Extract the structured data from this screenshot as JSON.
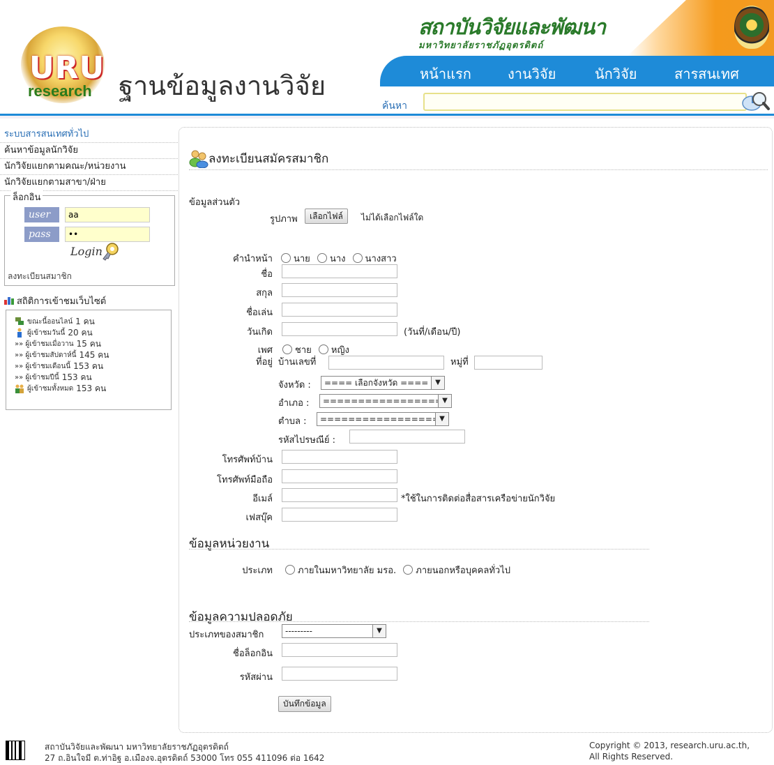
{
  "header": {
    "logo_main": "URU",
    "logo_sub": "research",
    "site_title": "ฐานข้อมูลงานวิจัย",
    "institute_name": "สถาบันวิจัยและพัฒนา",
    "institute_sub": "มหาวิทยาลัยราชภัฏอุตรดิตถ์",
    "nav": [
      "หน้าแรก",
      "งานวิจัย",
      "นักวิจัย",
      "สารสนเทศ"
    ],
    "search_label": "ค้นหา",
    "search_value": ""
  },
  "sidebar": {
    "links": [
      "ระบบสารสนเทศทั่วไป",
      "ค้นหาข้อมูลนักวิจัย",
      "นักวิจัยแยกตามคณะ/หน่วยงาน",
      "นักวิจัยแยกตามสาขา/ฝ่าย"
    ],
    "login": {
      "legend": "ล็อกอิน",
      "user_label": "user",
      "user_value": "aa",
      "pass_label": "pass",
      "pass_value": "••",
      "button": "Login",
      "register": "ลงทะเบียนสมาชิก"
    },
    "stats_title": "สถิติการเข้าชมเว็บไซต์",
    "stats": [
      {
        "label": "ขณะนี้ออนไลน์",
        "value": "1 คน",
        "icon": "online-users-icon"
      },
      {
        "label": "ผู้เข้าชมวันนี้",
        "value": "20 คน",
        "icon": "visitor-today-icon"
      },
      {
        "label": "»» ผู้เข้าชมเมื่อวาน",
        "value": "15 คน",
        "icon": ""
      },
      {
        "label": "»» ผู้เข้าชมสัปดาห์นี้",
        "value": "145 คน",
        "icon": ""
      },
      {
        "label": "»» ผู้เข้าชมเดือนนี้",
        "value": "153 คน",
        "icon": ""
      },
      {
        "label": "»» ผู้เข้าชมปีนี้",
        "value": "153 คน",
        "icon": ""
      },
      {
        "label": "ผู้เข้าชมทั้งหมด",
        "value": "153 คน",
        "icon": "total-users-icon"
      }
    ]
  },
  "form": {
    "title": "ลงทะเบียนสมัครสมาชิก",
    "personal_section": "ข้อมูลส่วนตัว",
    "photo_label": "รูปภาพ",
    "file_button": "เลือกไฟล์",
    "file_status": "ไม่ได้เลือกไฟล์ใด",
    "prefix_label": "คำนำหน้า",
    "prefix_options": [
      "นาย",
      "นาง",
      "นางสาว"
    ],
    "firstname_label": "ชื่อ",
    "lastname_label": "สกุล",
    "nickname_label": "ชื่อเล่น",
    "birthdate_label": "วันเกิด",
    "birthdate_hint": "(วันที่/เดือน/ปี)",
    "gender_label": "เพศ",
    "gender_options": [
      "ชาย",
      "หญิง"
    ],
    "address_label": "ที่อยู่",
    "house_no_label": "บ้านเลขที่",
    "moo_label": "หมู่ที่",
    "province_label": "จังหวัด :",
    "province_value": "==== เลือกจังหวัด ====",
    "district_label": "อำเภอ :",
    "district_value": "==================",
    "subdistrict_label": "ตำบล :",
    "subdistrict_value": "==================",
    "postcode_label": "รหัสไปรษณีย์ :",
    "home_phone_label": "โทรศัพท์บ้าน",
    "mobile_label": "โทรศัพท์มือถือ",
    "email_label": "อีเมล์",
    "email_hint": "*ใช้ในการติดต่อสื่อสารเครือข่ายนักวิจัย",
    "facebook_label": "เฟสบุ๊ค",
    "org_section": "ข้อมูลหน่วยงาน",
    "org_type_label": "ประเภท",
    "org_type_options": [
      "ภายในมหาวิทยาลัย มรอ.",
      "ภายนอกหรือบุคคลทั่วไป"
    ],
    "security_section": "ข้อมูลความปลอดภัย",
    "member_type_label": "ประเภทของสมาชิก",
    "member_type_value": "---------",
    "username_label": "ชื่อล็อกอิน",
    "password_label": "รหัสผ่าน",
    "submit_button": "บันทึกข้อมูล"
  },
  "footer": {
    "org": "สถาบันวิจัยและพัฒนา มหาวิทยาลัยราชภัฏอุตรดิตถ์",
    "address": "27 ถ.อินใจมี ต.ท่าอิฐ อ.เมืองจ.อุตรดิตถ์ 53000  โทร 055 411096 ต่อ 1642",
    "copyright": "Copyright © 2013, research.uru.ac.th,",
    "rights": "All Rights Reserved."
  },
  "colors": {
    "nav_blue": "#1e8bd8",
    "accent_orange": "#f39a21",
    "brand_green": "#2a7a2a",
    "link_blue": "#2a6fb5"
  }
}
